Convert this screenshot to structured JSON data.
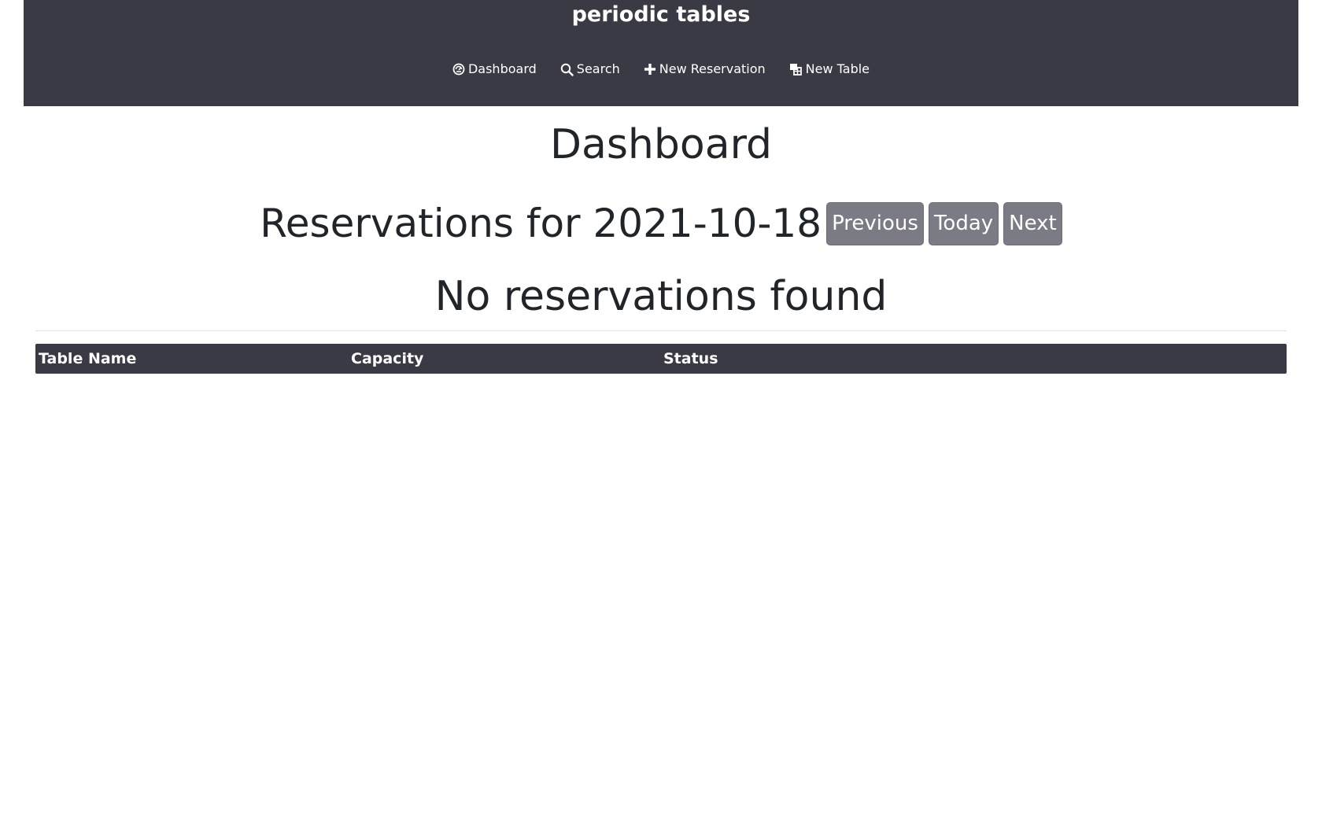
{
  "header": {
    "brand": "periodic tables",
    "nav": [
      {
        "label": "Dashboard",
        "icon": "dashboard-icon"
      },
      {
        "label": "Search",
        "icon": "search-icon"
      },
      {
        "label": "New Reservation",
        "icon": "plus-icon"
      },
      {
        "label": "New Table",
        "icon": "new-table-icon"
      }
    ]
  },
  "main": {
    "title": "Dashboard",
    "reservations_heading": "Reservations for 2021-10-18",
    "buttons": {
      "previous": "Previous",
      "today": "Today",
      "next": "Next"
    },
    "empty_message": "No reservations found"
  },
  "tables": {
    "columns": [
      "Table Name",
      "Capacity",
      "Status"
    ]
  },
  "colors": {
    "header_bg": "#3a3a45",
    "button_bg": "#7b7b86",
    "text": "#212529"
  }
}
